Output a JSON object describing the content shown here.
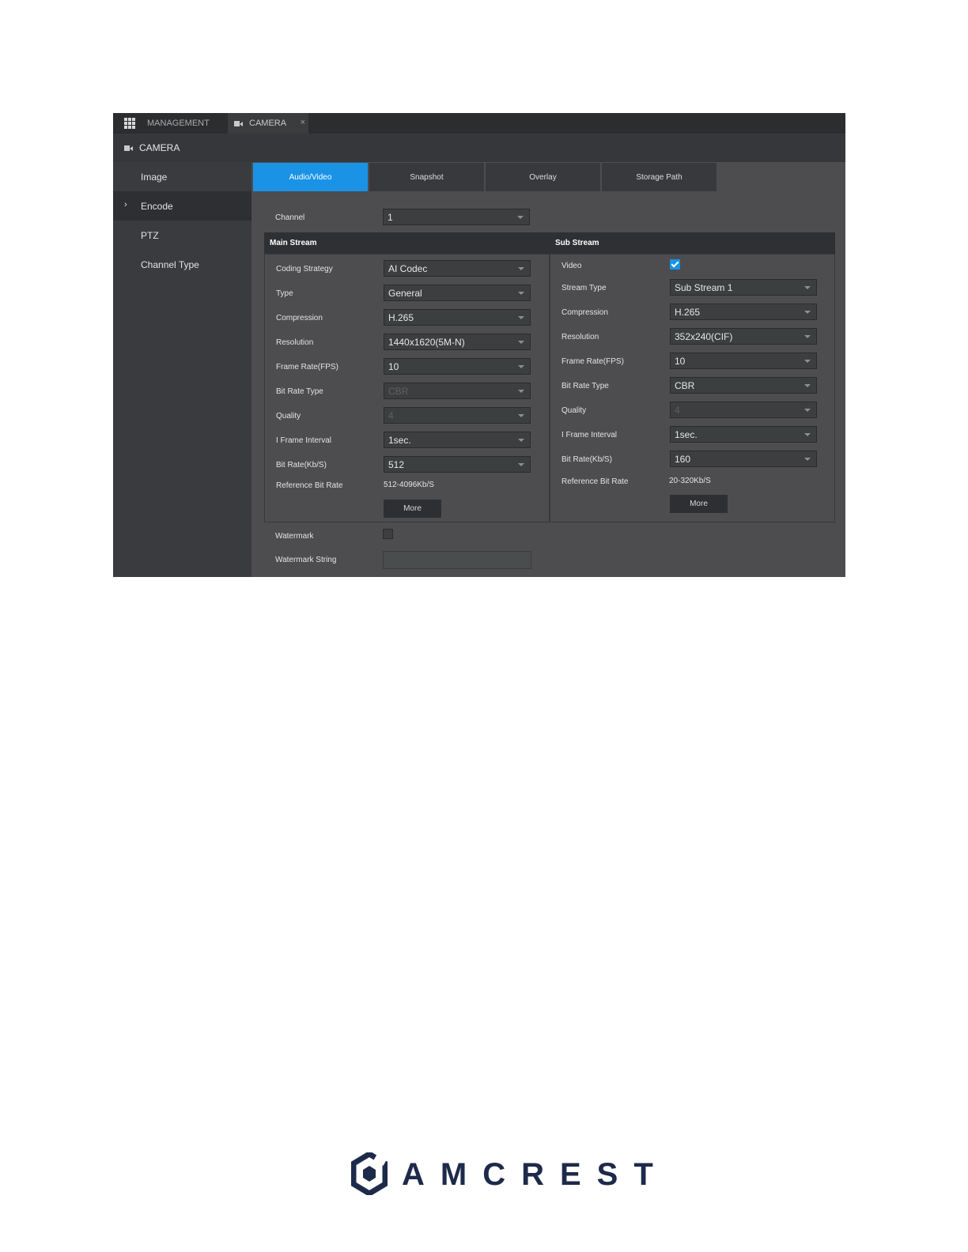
{
  "tabs": [
    {
      "label": "MANAGEMENT",
      "icon": "grid-icon"
    },
    {
      "label": "CAMERA",
      "icon": "camera-icon",
      "close": "×"
    }
  ],
  "section_title": "CAMERA",
  "sidebar": {
    "items": [
      {
        "label": "Image"
      },
      {
        "label": "Encode",
        "active": true
      },
      {
        "label": "PTZ"
      },
      {
        "label": "Channel Type"
      }
    ]
  },
  "subtabs": [
    "Audio/Video",
    "Snapshot",
    "Overlay",
    "Storage Path"
  ],
  "channel": {
    "label": "Channel",
    "value": "1"
  },
  "main_stream": {
    "title": "Main Stream",
    "fields": [
      {
        "label": "Coding Strategy",
        "value": "AI Codec"
      },
      {
        "label": "Type",
        "value": "General"
      },
      {
        "label": "Compression",
        "value": "H.265"
      },
      {
        "label": "Resolution",
        "value": "1440x1620(5M-N)"
      },
      {
        "label": "Frame Rate(FPS)",
        "value": "10"
      },
      {
        "label": "Bit Rate Type",
        "value": "CBR"
      },
      {
        "label": "Quality",
        "value": "4"
      },
      {
        "label": "I Frame Interval",
        "value": "1sec."
      },
      {
        "label": "Bit Rate(Kb/S)",
        "value": "512"
      }
    ],
    "reference_label": "Reference Bit Rate",
    "reference_value": "512-4096Kb/S",
    "more": "More"
  },
  "sub_stream": {
    "title": "Sub Stream",
    "video_label": "Video",
    "video_checked": true,
    "fields": [
      {
        "label": "Stream Type",
        "value": "Sub Stream 1"
      },
      {
        "label": "Compression",
        "value": "H.265"
      },
      {
        "label": "Resolution",
        "value": "352x240(CIF)"
      },
      {
        "label": "Frame Rate(FPS)",
        "value": "10"
      },
      {
        "label": "Bit Rate Type",
        "value": "CBR"
      },
      {
        "label": "Quality",
        "value": "4"
      },
      {
        "label": "I Frame Interval",
        "value": "1sec."
      },
      {
        "label": "Bit Rate(Kb/S)",
        "value": "160"
      }
    ],
    "reference_label": "Reference Bit Rate",
    "reference_value": "20-320Kb/S",
    "more": "More"
  },
  "watermark": {
    "label": "Watermark",
    "checked": false
  },
  "watermark_string": {
    "label": "Watermark String",
    "value": ""
  },
  "logo": {
    "text": "AMCREST"
  },
  "colors": {
    "accent": "#1a93e6",
    "panel": "#4d4d4f",
    "sidebar": "#3a3b3e",
    "logo": "#1e2a4a"
  }
}
